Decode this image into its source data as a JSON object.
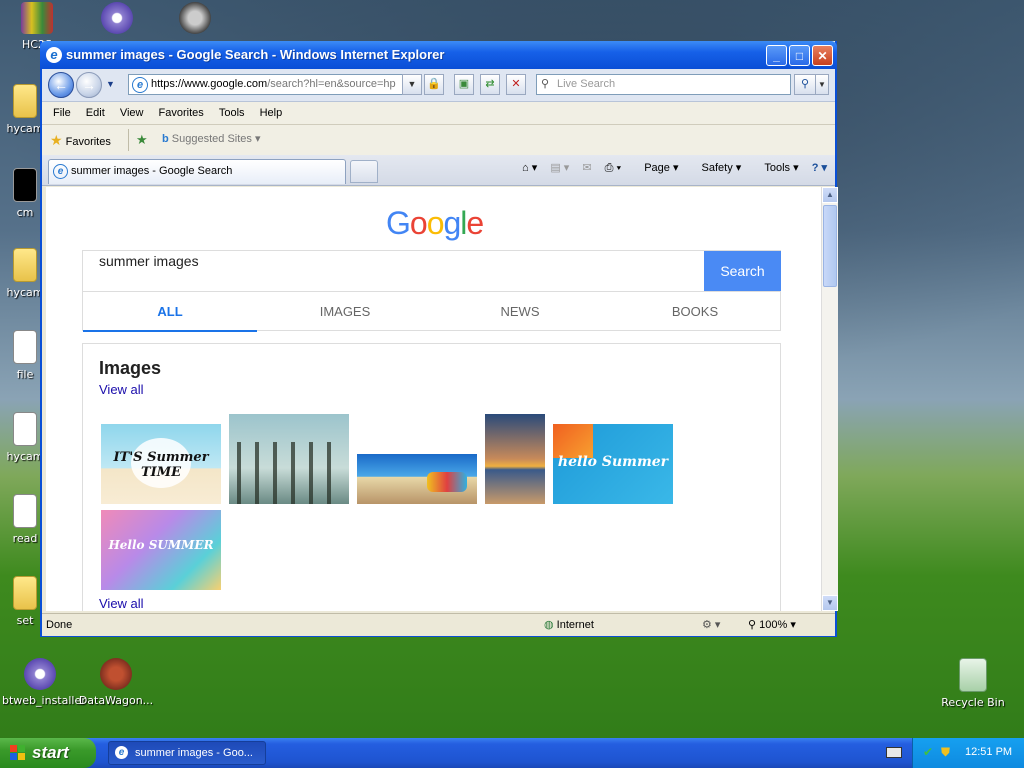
{
  "desktop": {
    "icons": [
      {
        "label": "HC2S",
        "name": "desktop-icon-hc2s"
      },
      {
        "label": "hycam",
        "name": "desktop-icon-hycam-folder"
      },
      {
        "label": "cm",
        "name": "desktop-icon-cmd"
      },
      {
        "label": "hycam",
        "name": "desktop-icon-hycam-folder-2"
      },
      {
        "label": "file",
        "name": "desktop-icon-file"
      },
      {
        "label": "hycam",
        "name": "desktop-icon-hycam-doc"
      },
      {
        "label": "read",
        "name": "desktop-icon-readme"
      },
      {
        "label": "set",
        "name": "desktop-icon-setup"
      },
      {
        "label": "btweb_installer",
        "name": "desktop-icon-btweb"
      },
      {
        "label": "DataWagon...",
        "name": "desktop-icon-datawagon"
      },
      {
        "label": "Recycle Bin",
        "name": "desktop-icon-recycle-bin"
      }
    ]
  },
  "window": {
    "title": "summer images - Google Search - Windows Internet Explorer",
    "url_prefix": "https://",
    "url_host": "www.google.com",
    "url_path": "/search?hl=en&source=hp",
    "search_placeholder": "Live Search",
    "menu": [
      "File",
      "Edit",
      "View",
      "Favorites",
      "Tools",
      "Help"
    ],
    "favorites_label": "Favorites",
    "suggested_sites": "Suggested Sites",
    "tab_title": "summer images - Google Search",
    "commands": {
      "page": "Page",
      "safety": "Safety",
      "tools": "Tools"
    },
    "status": {
      "text": "Done",
      "zone": "Internet",
      "zoom": "100%"
    }
  },
  "google": {
    "logo": [
      "G",
      "o",
      "o",
      "g",
      "l",
      "e"
    ],
    "logo_colors": [
      "#4285F4",
      "#EA4335",
      "#FBBC05",
      "#4285F4",
      "#34A853",
      "#EA4335"
    ],
    "query": "summer images",
    "search_button": "Search",
    "tabs": [
      "ALL",
      "IMAGES",
      "NEWS",
      "BOOKS"
    ],
    "active_tab": "ALL",
    "images_heading": "Images",
    "view_all": "View all",
    "thumb_captions": {
      "its_summer": "IT'S Summer TIME",
      "hello_summer_blue": "hello Summer",
      "hello_summer_tropical": "Hello SUMMER"
    }
  },
  "taskbar": {
    "start": "start",
    "task": "summer images - Goo...",
    "clock": "12:51 PM"
  },
  "colors": {
    "accent": "#4A8AF4",
    "link": "#1A0DAB",
    "titlebar": "#0A4FD6"
  }
}
